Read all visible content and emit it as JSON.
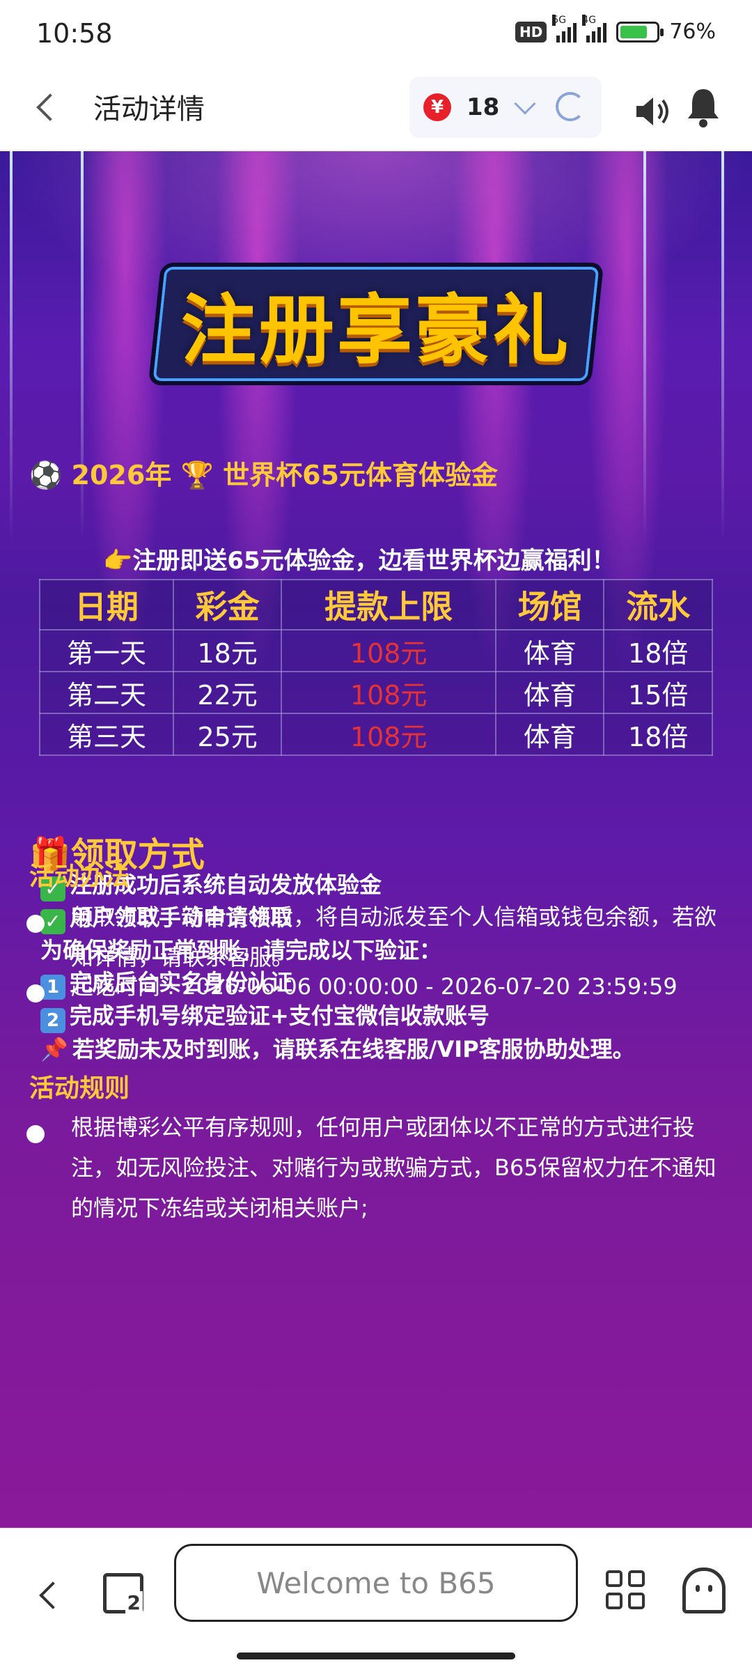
{
  "status_bar": {
    "time": "10:58",
    "hd_label": "HD",
    "net1": "5G",
    "net2": "4G",
    "battery": "76%",
    "battery_level": 0.76
  },
  "header": {
    "title": "活动详情",
    "balance": "18",
    "currency_icon": "¥"
  },
  "banner": {
    "headline": "注册享豪礼",
    "subtitle": "⚽ 2026年 🏆 世界杯65元体育体验金",
    "promo": "👉注册即送65元体验金，边看世界杯边赢福利！",
    "table": {
      "headers": [
        "日期",
        "彩金",
        "提款上限",
        "场馆",
        "流水"
      ],
      "rows": [
        [
          "第一天",
          "18元",
          "108元",
          "体育",
          "18倍"
        ],
        [
          "第二天",
          "22元",
          "108元",
          "体育",
          "15倍"
        ],
        [
          "第三天",
          "25元",
          "108元",
          "体育",
          "18倍"
        ]
      ]
    },
    "claim": {
      "title": "🎁领取方式",
      "line1": "注册成功后系统自动发放体验金",
      "line2": "用户领取手动申请领取",
      "line3": "为确保奖励正常到账，请完成以下验证：",
      "line4": "完成后台实名身份认证",
      "line5": "完成手机号绑定验证+支付宝微信收款账号",
      "line6": "若奖励未及时到账，请联系在线客服/VIP客服协助处理。"
    },
    "method": {
      "title": "活动办法",
      "item1": "领取方式 : 符合资格后，将自动派发至个人信箱或钱包余额，若欲知详情，请联系客服。",
      "item2": "起讫时间 : 2026-06-06 00:00:00 - 2026-07-20 23:59:59"
    },
    "rules": {
      "title": "活动规则",
      "item1": "根据博彩公平有序规则，任何用户或团体以不正常的方式进行投注，如无风险投注、对赌行为或欺骗方式，B65保留权力在不通知的情况下冻结或关闭相关账户;"
    }
  },
  "bottom_bar": {
    "url_text": "Welcome to B65",
    "tab_count": "2"
  }
}
